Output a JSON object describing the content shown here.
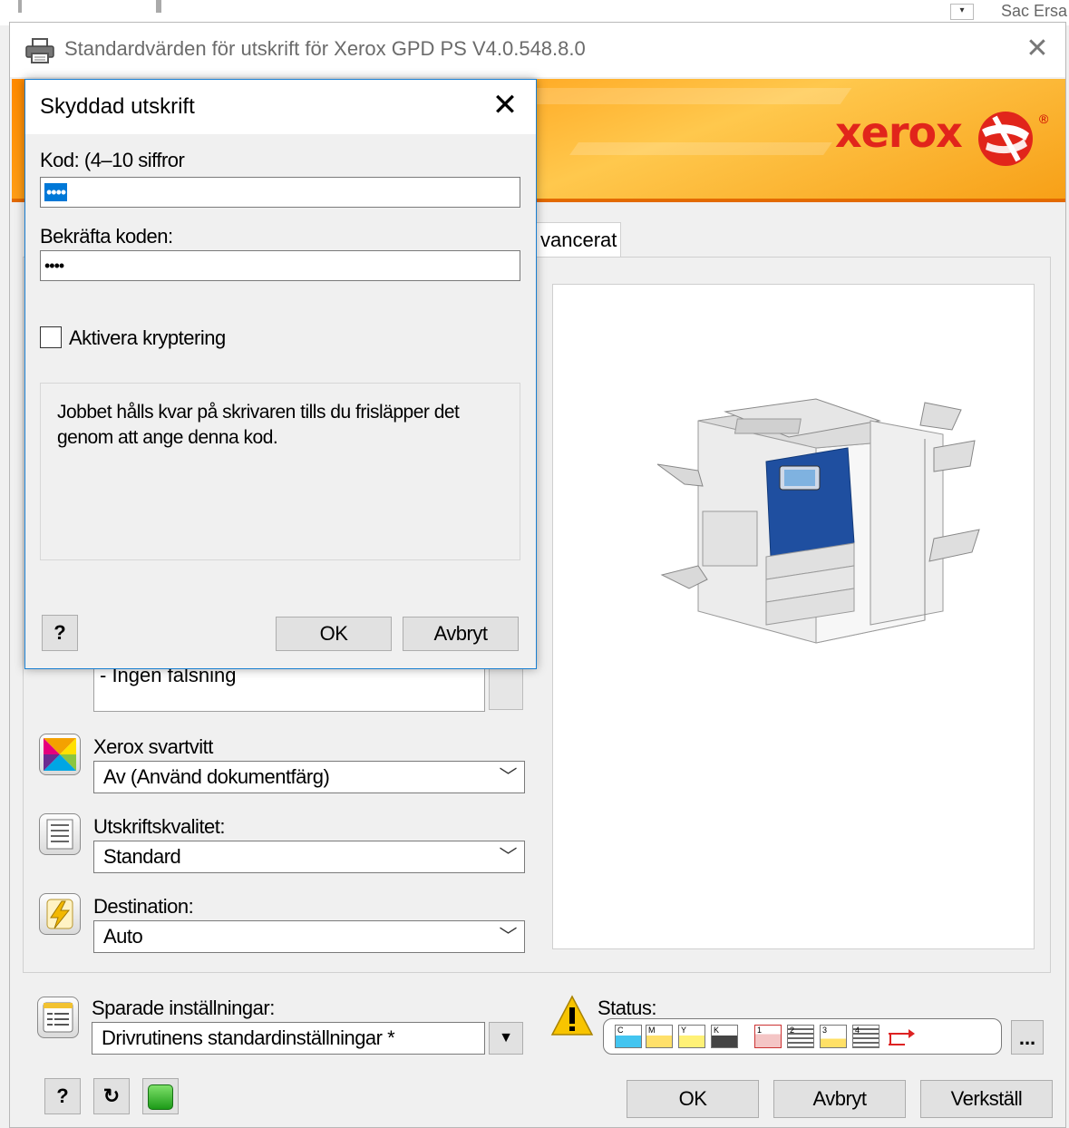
{
  "background": {
    "fragment_text": "Sac Ersa"
  },
  "main_window": {
    "title": "Standardvärden för utskrift för Xerox GPD PS V4.0.548.8.0",
    "brand": "xerox",
    "tab_label": "vancerat",
    "hidden_listbox_text": "- Ingen falsning",
    "color_mode": {
      "label": "Xerox svartvitt",
      "value": "Av (Använd dokumentfärg)"
    },
    "print_quality": {
      "label": "Utskriftskvalitet:",
      "value": "Standard"
    },
    "destination": {
      "label": "Destination:",
      "value": "Auto"
    },
    "saved_settings": {
      "label": "Sparade inställningar:",
      "value": "Drivrutinens standardinställningar *"
    },
    "status": {
      "label": "Status:",
      "more_label": "...",
      "cartridges": [
        "C",
        "M",
        "Y",
        "K"
      ],
      "trays": [
        "1",
        "2",
        "3",
        "4"
      ]
    },
    "buttons": {
      "help": "?",
      "ok": "OK",
      "cancel": "Avbryt",
      "apply": "Verkställ"
    }
  },
  "dialog": {
    "title": "Skyddad utskrift",
    "code_label": "Kod: (4–10 siffror",
    "code_value": "••••",
    "confirm_label": "Bekräfta koden:",
    "confirm_value": "••••",
    "encrypt_label": "Aktivera kryptering",
    "encrypt_checked": false,
    "info_text": "Jobbet hålls kvar på skrivaren tills du frisläpper det genom att ange denna kod.",
    "help_label": "?",
    "ok_label": "OK",
    "cancel_label": "Avbryt"
  },
  "colors": {
    "accent": "#0078d7",
    "banner_orange": "#ff8a00",
    "xerox_red": "#e1251b"
  }
}
